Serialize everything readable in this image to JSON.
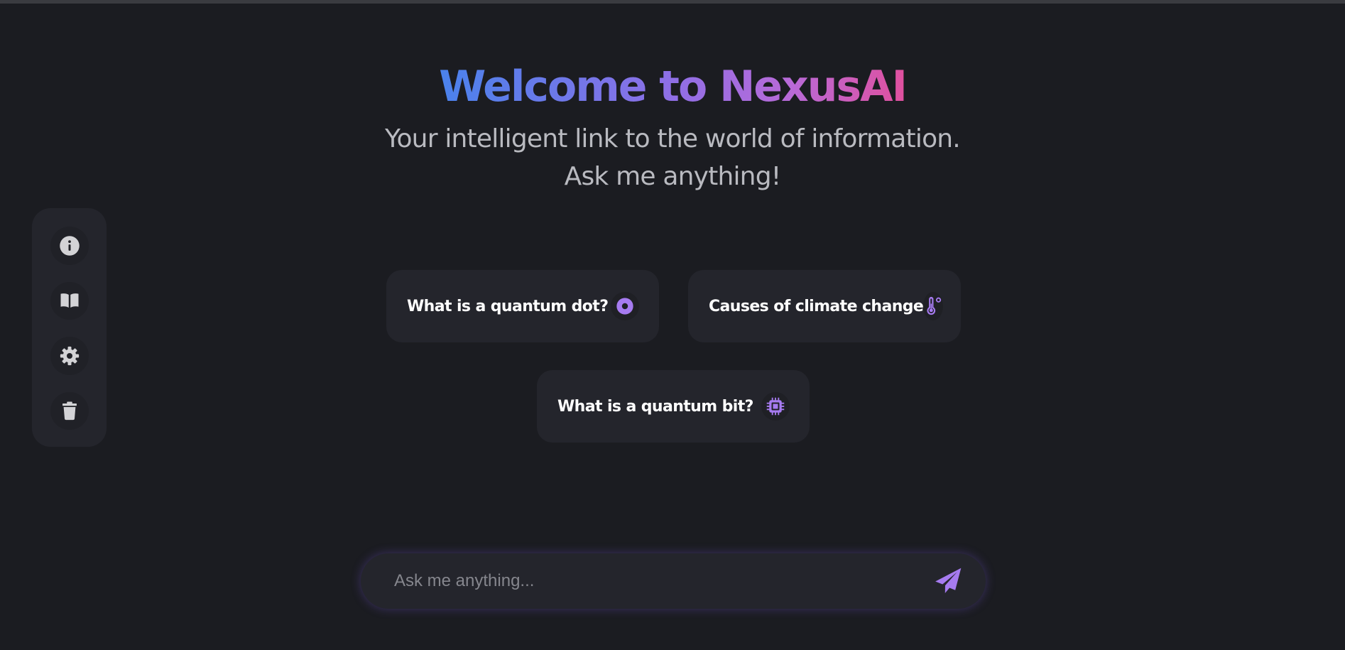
{
  "hero": {
    "title": "Welcome to NexusAI",
    "subtitle": "Your intelligent link to the world of information. Ask me anything!"
  },
  "sidebar": {
    "items": [
      {
        "icon": "info-icon"
      },
      {
        "icon": "book-icon"
      },
      {
        "icon": "gear-icon"
      },
      {
        "icon": "trash-icon"
      }
    ]
  },
  "suggestions": [
    {
      "label": "What is a quantum dot?",
      "icon": "dot-circle-icon"
    },
    {
      "label": "Causes of climate change",
      "icon": "thermometer-icon"
    },
    {
      "label": "What is a quantum bit?",
      "icon": "chip-icon"
    }
  ],
  "chat": {
    "placeholder": "Ask me anything...",
    "value": "",
    "send_icon": "send-icon"
  },
  "colors": {
    "background": "#1b1c21",
    "panel": "#24252c",
    "accent": "#a67bf0",
    "icon_gray": "#d3d3d6",
    "title_gradient": [
      "#4a82ec",
      "#8f6fe6",
      "#e0509e"
    ]
  }
}
